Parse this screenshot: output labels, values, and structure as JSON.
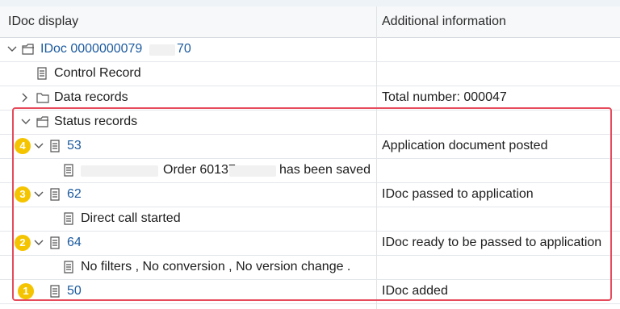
{
  "header": {
    "col1": "IDoc display",
    "col2": "Additional information"
  },
  "tree": {
    "idoc": {
      "number": "IDoc 0000000079",
      "suffix": "70"
    },
    "control_record": "Control Record",
    "data_records": {
      "label": "Data records",
      "info": "Total number: 000047"
    },
    "status_records": "Status records",
    "statuses": [
      {
        "badge": "4",
        "code": "53",
        "info": "Application document posted",
        "detail_a": "Order 60137",
        "detail_b": "has been saved"
      },
      {
        "badge": "3",
        "code": "62",
        "info": "IDoc passed to application",
        "detail": "Direct call started"
      },
      {
        "badge": "2",
        "code": "64",
        "info": "IDoc ready to be passed to application",
        "detail": "No filters , No conversion , No version change ."
      },
      {
        "badge": "1",
        "code": "50",
        "info": "IDoc added"
      }
    ]
  },
  "colors": {
    "link": "#1c5a9e",
    "highlight_border": "#e54b5b",
    "badge": "#f5c400"
  },
  "icons": [
    "chevron-down-icon",
    "chevron-right-icon",
    "folder-open-icon",
    "folder-icon",
    "document-icon"
  ]
}
